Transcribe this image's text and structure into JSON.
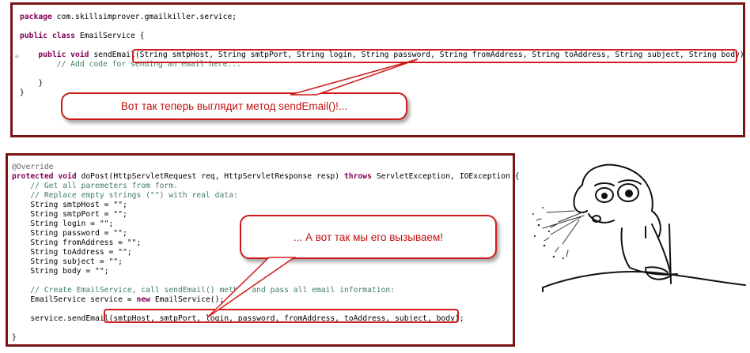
{
  "top_panel": {
    "code_lines": [
      {
        "segments": [
          {
            "t": "package",
            "c": "kw"
          },
          {
            "t": " com.skillsimprover.gmailkiller.service;",
            "c": ""
          }
        ]
      },
      {
        "segments": [
          {
            "t": " ",
            "c": ""
          }
        ]
      },
      {
        "segments": [
          {
            "t": "public class",
            "c": "kw"
          },
          {
            "t": " EmailService {",
            "c": ""
          }
        ]
      },
      {
        "segments": [
          {
            "t": " ",
            "c": ""
          }
        ]
      },
      {
        "segments": [
          {
            "t": "    ",
            "c": ""
          },
          {
            "t": "public void",
            "c": "kw"
          },
          {
            "t": " sendEmail(String smtpHost, String smtpPort, String login, String password, String fromAddress, String toAddress, String subject, String body) {",
            "c": ""
          }
        ]
      },
      {
        "segments": [
          {
            "t": "        ",
            "c": ""
          },
          {
            "t": "// Add code for sending an email here...",
            "c": "cm"
          }
        ]
      },
      {
        "segments": [
          {
            "t": " ",
            "c": ""
          }
        ]
      },
      {
        "segments": [
          {
            "t": "    }",
            "c": ""
          }
        ]
      },
      {
        "segments": [
          {
            "t": "}",
            "c": ""
          }
        ]
      }
    ],
    "callout_text": "Вот так теперь выглядит метод sendEmail()!..."
  },
  "bottom_panel": {
    "code_lines": [
      {
        "segments": [
          {
            "t": "@Override",
            "c": "an"
          }
        ]
      },
      {
        "segments": [
          {
            "t": "protected void",
            "c": "kw"
          },
          {
            "t": " doPost(HttpServletRequest req, HttpServletResponse resp) ",
            "c": ""
          },
          {
            "t": "throws",
            "c": "kw"
          },
          {
            "t": " ServletException, IOException {",
            "c": ""
          }
        ]
      },
      {
        "segments": [
          {
            "t": "    ",
            "c": ""
          },
          {
            "t": "// Get all paremeters from form.",
            "c": "cm"
          }
        ]
      },
      {
        "segments": [
          {
            "t": "    ",
            "c": ""
          },
          {
            "t": "// Replace empty strings (\"\") with real data:",
            "c": "cm"
          }
        ]
      },
      {
        "segments": [
          {
            "t": "    String smtpHost = \"\";",
            "c": ""
          }
        ]
      },
      {
        "segments": [
          {
            "t": "    String smtpPort = \"\";",
            "c": ""
          }
        ]
      },
      {
        "segments": [
          {
            "t": "    String login = \"\";",
            "c": ""
          }
        ]
      },
      {
        "segments": [
          {
            "t": "    String password = \"\";",
            "c": ""
          }
        ]
      },
      {
        "segments": [
          {
            "t": "    String fromAddress = \"\";",
            "c": ""
          }
        ]
      },
      {
        "segments": [
          {
            "t": "    String toAddress = \"\";",
            "c": ""
          }
        ]
      },
      {
        "segments": [
          {
            "t": "    String subject = \"\";",
            "c": ""
          }
        ]
      },
      {
        "segments": [
          {
            "t": "    String body = \"\";",
            "c": ""
          }
        ]
      },
      {
        "segments": [
          {
            "t": " ",
            "c": ""
          }
        ]
      },
      {
        "segments": [
          {
            "t": "    ",
            "c": ""
          },
          {
            "t": "// Create EmailService, call sendEmail() method and pass all email information:",
            "c": "cm"
          }
        ]
      },
      {
        "segments": [
          {
            "t": "    EmailService service = ",
            "c": ""
          },
          {
            "t": "new",
            "c": "kw"
          },
          {
            "t": " EmailService();",
            "c": ""
          }
        ]
      },
      {
        "segments": [
          {
            "t": " ",
            "c": ""
          }
        ]
      },
      {
        "segments": [
          {
            "t": "    service.sendEmail(smtpHost, smtpPort, login, password, fromAddress, toAddress, subject, body);",
            "c": ""
          }
        ]
      },
      {
        "segments": [
          {
            "t": " ",
            "c": ""
          }
        ]
      },
      {
        "segments": [
          {
            "t": "}",
            "c": ""
          }
        ]
      }
    ],
    "callout_text": "... А вот так мы его вызываем!"
  },
  "colors": {
    "panel_border": "#7a1414",
    "highlight_border": "#d11d1d",
    "callout_text": "#c01010",
    "keyword": "#7f0055",
    "comment": "#3f7f5f",
    "annotation": "#646464"
  },
  "meme": {
    "icon": "spitting-reaction-meme-face"
  }
}
